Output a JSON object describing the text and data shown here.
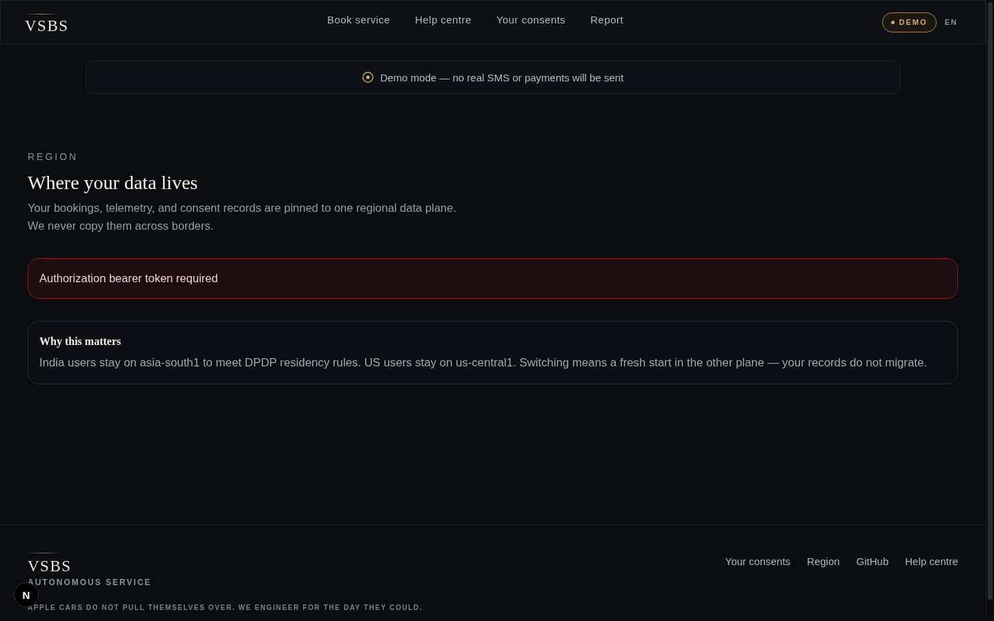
{
  "header": {
    "logo": "VSBS",
    "nav": [
      {
        "label": "Book service"
      },
      {
        "label": "Help centre"
      },
      {
        "label": "Your consents"
      },
      {
        "label": "Report"
      }
    ],
    "demo_badge": "DEMO",
    "language": "EN"
  },
  "demo_banner": {
    "text": "Demo mode — no real SMS or payments will be sent"
  },
  "region": {
    "eyebrow": "REGION",
    "title": "Where your data lives",
    "description": "Your bookings, telemetry, and consent records are pinned to one regional data plane. We never copy them across borders."
  },
  "alert": {
    "kind": "error",
    "message": "Authorization bearer token required"
  },
  "info_card": {
    "title": "Why this matters",
    "body": "India users stay on asia-south1 to meet DPDP residency rules. US users stay on us-central1. Switching means a fresh start in the other plane — your records do not migrate."
  },
  "footer": {
    "logo": "VSBS",
    "subtitle": "AUTONOMOUS SERVICE",
    "tagline": "APPLE CARS DO NOT PULL THEMSELVES OVER. WE ENGINEER FOR THE DAY THEY COULD.",
    "links": [
      {
        "label": "Your consents"
      },
      {
        "label": "Region"
      },
      {
        "label": "GitHub"
      },
      {
        "label": "Help centre"
      }
    ]
  },
  "dev_badge": {
    "label": "N"
  }
}
